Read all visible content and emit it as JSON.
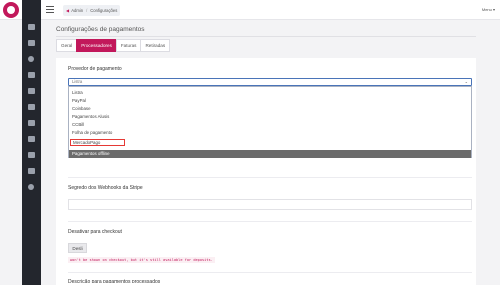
{
  "header": {
    "breadcrumb_home": "Admin",
    "breadcrumb_current": "Configurações",
    "user_menu": "Menu ▾"
  },
  "sidebar": {
    "icons": [
      "home-icon",
      "folder-icon",
      "user-icon",
      "cart-icon",
      "card-icon",
      "tag-icon",
      "list-icon",
      "calendar-icon",
      "document-icon",
      "chart-icon",
      "settings-icon"
    ]
  },
  "page": {
    "title": "Configurações de pagamentos"
  },
  "tabs": [
    {
      "label": "Geral",
      "active": false
    },
    {
      "label": "Processadores",
      "active": true
    },
    {
      "label": "Faturas",
      "active": false
    },
    {
      "label": "Retiradas",
      "active": false
    }
  ],
  "provider": {
    "label": "Provedor de pagamento",
    "selected": "Listra",
    "options": [
      "Listra",
      "PayPal",
      "Coinbase",
      "Pagamentos Alusis",
      "CCBill",
      "Folha de pagamento",
      "MercadoPago"
    ],
    "highlighted_option": "Pagamentos offline"
  },
  "webhooks": {
    "label": "Segredo dos Webhooks da Stripe",
    "value": ""
  },
  "checkout": {
    "label": "Desativar para checkout",
    "button_label": "Desli",
    "help_text": "won't be shown on checkout, but it's still available for deposits."
  },
  "next_section": {
    "label": "Descrição para pagamentos processados"
  }
}
